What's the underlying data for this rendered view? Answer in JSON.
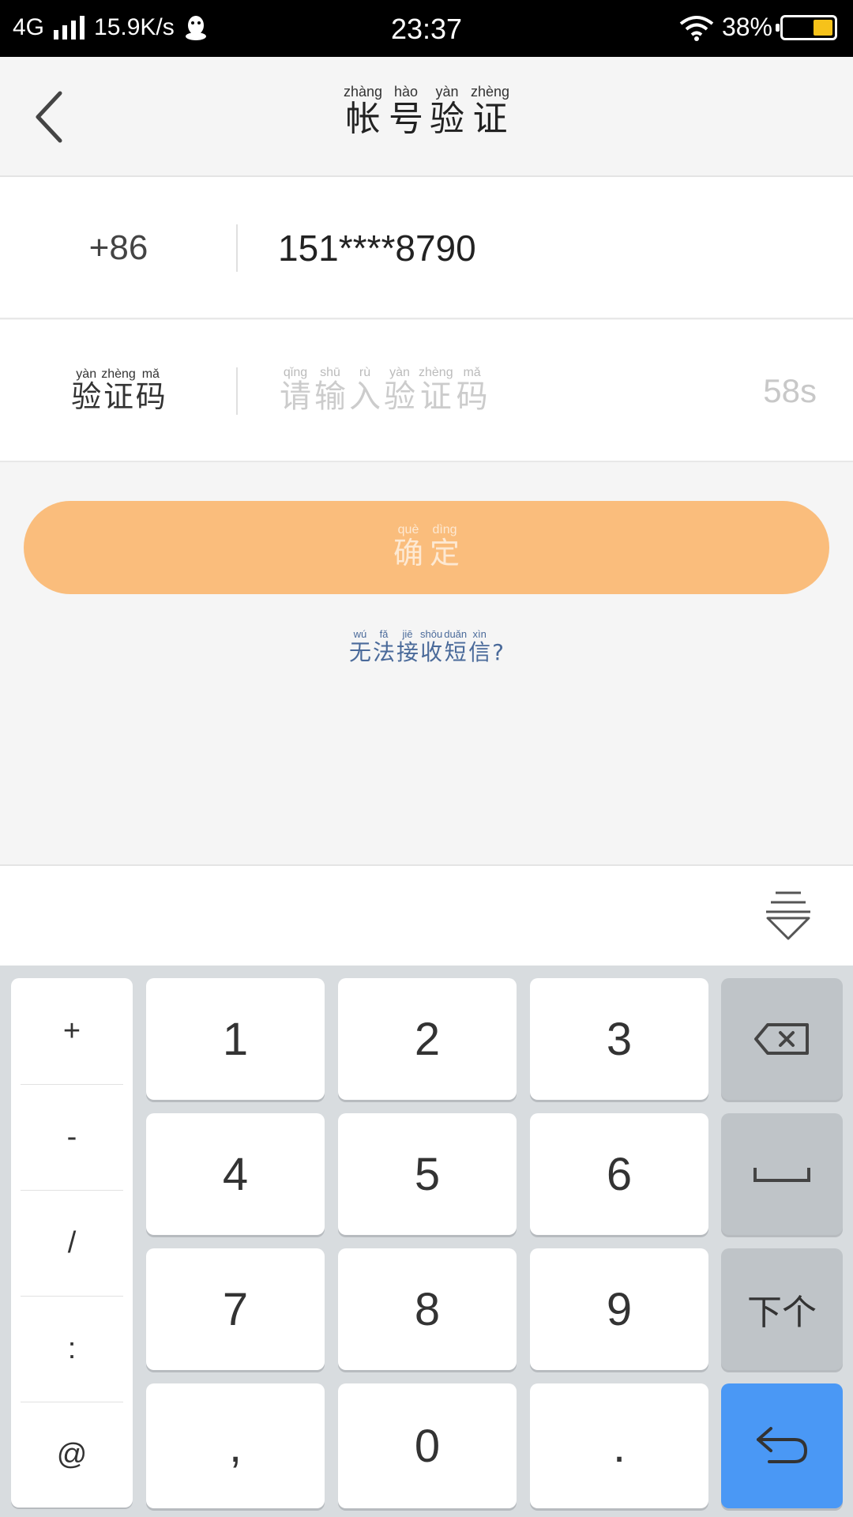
{
  "status_bar": {
    "network": "4G",
    "speed": "15.9K/s",
    "time": "23:37",
    "battery": "38%"
  },
  "header": {
    "title": [
      {
        "char": "帐",
        "pinyin": "zhàng"
      },
      {
        "char": "号",
        "pinyin": "hào"
      },
      {
        "char": "验",
        "pinyin": "yàn"
      },
      {
        "char": "证",
        "pinyin": "zhèng"
      }
    ]
  },
  "phone_row": {
    "country_code": "+86",
    "phone_number": "151****8790"
  },
  "code_row": {
    "label": [
      {
        "char": "验",
        "pinyin": "yàn"
      },
      {
        "char": "证",
        "pinyin": "zhèng"
      },
      {
        "char": "码",
        "pinyin": "mǎ"
      }
    ],
    "placeholder": [
      {
        "char": "请",
        "pinyin": "qǐng"
      },
      {
        "char": "输",
        "pinyin": "shū"
      },
      {
        "char": "入",
        "pinyin": "rù"
      },
      {
        "char": "验",
        "pinyin": "yàn"
      },
      {
        "char": "证",
        "pinyin": "zhèng"
      },
      {
        "char": "码",
        "pinyin": "mǎ"
      }
    ],
    "countdown": "58s"
  },
  "confirm_button": [
    {
      "char": "确",
      "pinyin": "què"
    },
    {
      "char": "定",
      "pinyin": "dìng"
    }
  ],
  "sms_link": [
    {
      "char": "无",
      "pinyin": "wú"
    },
    {
      "char": "法",
      "pinyin": "fǎ"
    },
    {
      "char": "接",
      "pinyin": "jiē"
    },
    {
      "char": "收",
      "pinyin": "shōu"
    },
    {
      "char": "短",
      "pinyin": "duǎn"
    },
    {
      "char": "信",
      "pinyin": "xìn"
    },
    {
      "char": "?",
      "pinyin": ""
    }
  ],
  "keyboard": {
    "symbols": [
      "+",
      "-",
      "/",
      ":",
      "@"
    ],
    "digits": [
      "1",
      "2",
      "3",
      "4",
      "5",
      "6",
      "7",
      "8",
      "9",
      ",",
      "0",
      "."
    ],
    "next_label": "下个",
    "accent": "#4a98f5"
  }
}
